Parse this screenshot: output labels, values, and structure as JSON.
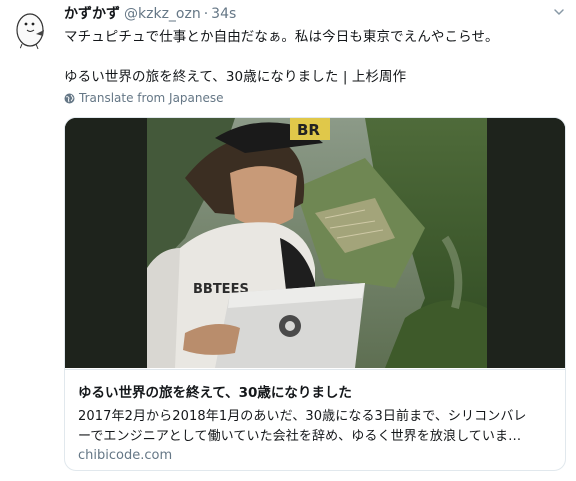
{
  "tweet": {
    "author_name": "かずかず",
    "handle": "@kzkz_ozn",
    "separator": "·",
    "time": "34s",
    "text_line1": "マチュピチュで仕事とか自由だなぁ。私は今日も東京でえんやこらせ。",
    "text_line2": "ゆるい世界の旅を終えて、30歳になりました | 上杉周作",
    "translate_label": "Translate from Japanese"
  },
  "card": {
    "title": "ゆるい世界の旅を終えて、30歳になりました",
    "description_line1": "2017年2月から2018年1月のあいだ、30歳になる3日前まで、シリコンバレ",
    "description_line2": "ーでエンジニアとして働いていた会社を辞め、ゆるく世界を放浪していま…",
    "domain": "chibicode.com"
  },
  "icons": {
    "avatar": "egg-doodle-avatar",
    "caret": "chevron-down-icon",
    "globe": "globe-icon"
  },
  "colors": {
    "text_primary": "#14171a",
    "text_secondary": "#657786",
    "card_border": "#e1e8ed"
  }
}
